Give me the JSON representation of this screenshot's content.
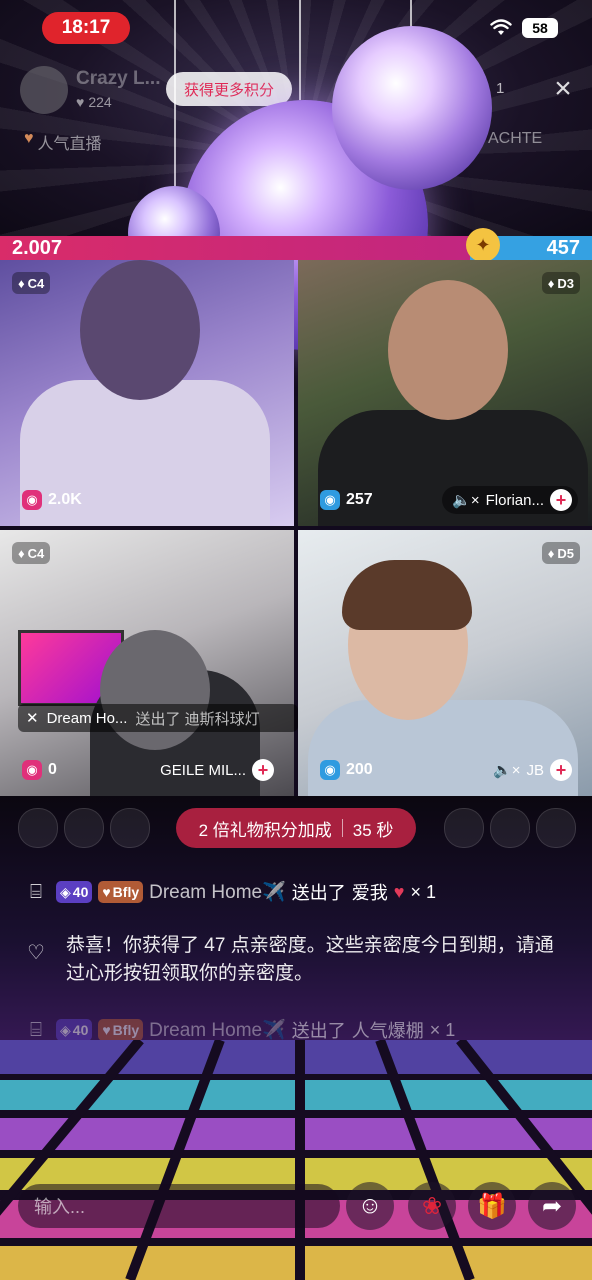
{
  "status_bar": {
    "time": "18:17",
    "battery": "58"
  },
  "host": {
    "name": "Crazy L...",
    "likes": "224"
  },
  "earn_button": "获得更多积分",
  "viewer_count": "1",
  "popular_tag": "人气直播",
  "right_tag": "ACHTE",
  "battle": {
    "left_score": "2.007",
    "right_score": "457"
  },
  "tiles": [
    {
      "tier": "C4",
      "score": "2.0K",
      "name": ""
    },
    {
      "tier": "D3",
      "score": "257",
      "name": "Florian..."
    },
    {
      "tier": "C4",
      "score": "0",
      "name": "GEILE MIL..."
    },
    {
      "tier": "D5",
      "score": "200",
      "name": "JB"
    }
  ],
  "gift_toast": {
    "user": "Dream Ho...",
    "action": "送出了 迪斯科球灯"
  },
  "boost": {
    "text": "2 倍礼物积分加成",
    "timer": "35 秒"
  },
  "chat": [
    {
      "level": "40",
      "badge": "Bfly",
      "user": "Dream Home✈️",
      "action": "送出了",
      "gift": "爱我",
      "count": "× 1"
    },
    {
      "system": "恭喜！你获得了 47 点亲密度。这些亲密度今日到期，请通过心形按钮领取你的亲密度。"
    },
    {
      "level": "40",
      "badge": "Bfly",
      "user": "Dream Home✈️",
      "action": "送出了",
      "gift": "人气爆棚",
      "count": "× 1"
    }
  ],
  "input_placeholder": "输入...",
  "colors": {
    "battle_left": "#d92c69",
    "battle_right": "#35a1e2",
    "time_pill": "#e0242c",
    "boost_pill": "#a8203f"
  },
  "icons": [
    "wifi-icon",
    "battery-icon",
    "close-icon",
    "heart-icon",
    "gift-icon",
    "emoji-icon",
    "rose-icon",
    "present-icon",
    "share-icon"
  ]
}
